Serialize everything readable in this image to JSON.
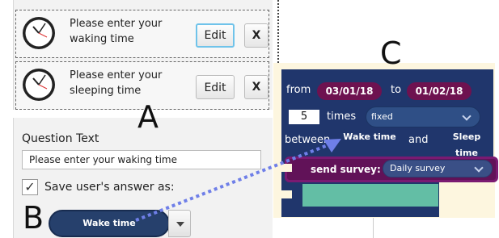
{
  "panel_labels": {
    "a": "A",
    "b": "B",
    "c": "C"
  },
  "question_list": [
    {
      "text": "Please enter your waking time",
      "edit_label": "Edit",
      "delete_label": "X",
      "icon": "clock-icon"
    },
    {
      "text": "Please enter your sleeping time",
      "edit_label": "Edit",
      "delete_label": "X",
      "icon": "clock-icon"
    }
  ],
  "editor": {
    "question_label": "Question Text",
    "question_value": "Please enter your waking time",
    "save_checked": "✓",
    "save_label": "Save user's answer as:",
    "answer_variable": "Wake time"
  },
  "block": {
    "from_label": "from",
    "start_date": "03/01/18",
    "to_label": "to",
    "end_date": "01/02/18",
    "times_value": "5",
    "times_label": "times",
    "frequency": "fixed",
    "between_label": "between",
    "wake_variable": "Wake time",
    "and_label": "and",
    "sleep_variable": "Sleep time",
    "send_label": "send survey:",
    "survey_value": "Daily survey"
  },
  "colors": {
    "block_blue": "#20366c",
    "date_purple": "#6e1250",
    "survey_purple": "#611258",
    "slot_teal": "#63bea5",
    "arrow_blue": "#6f7fe8"
  }
}
